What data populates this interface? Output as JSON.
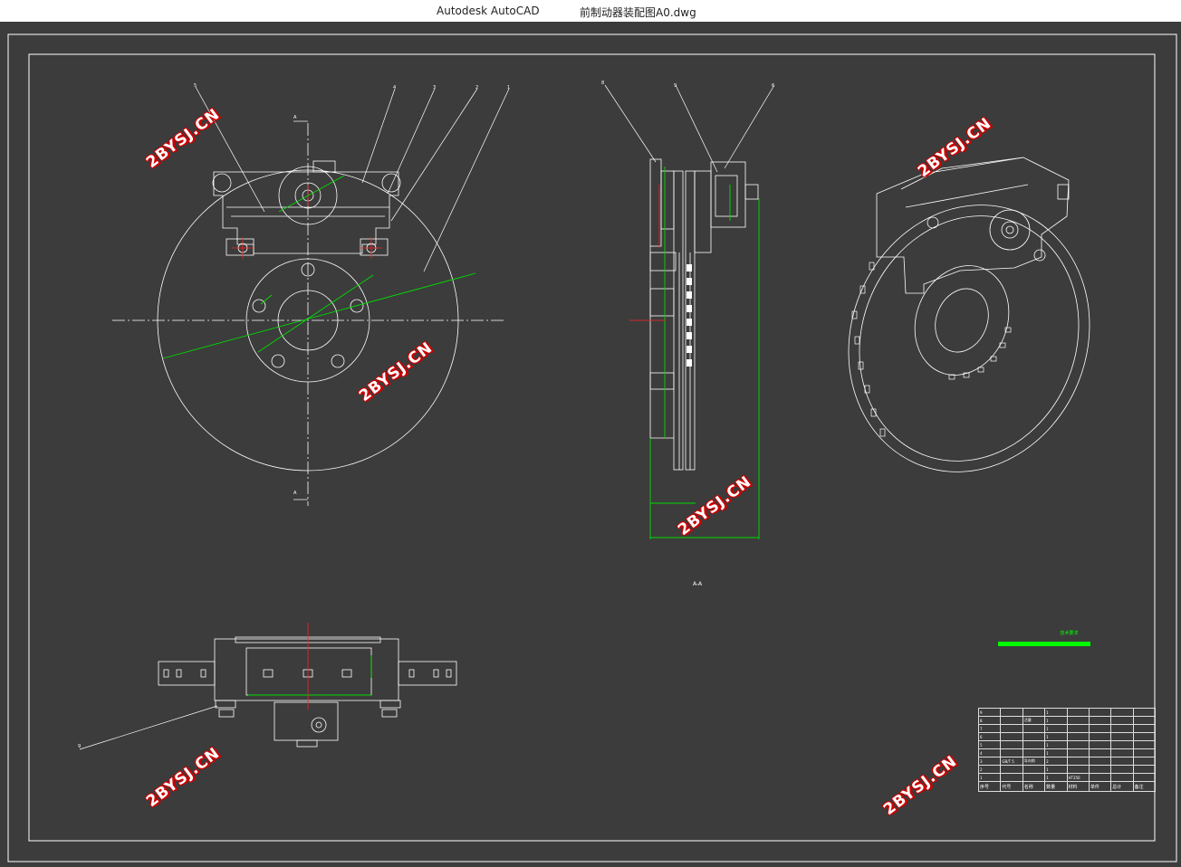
{
  "titlebar": {
    "app_name": "Autodesk AutoCAD",
    "document_name": "前制动器装配图A0.dwg"
  },
  "watermarks": [
    {
      "id": "wm1",
      "text": "2BYSJ.CN"
    },
    {
      "id": "wm2",
      "text": "2BYSJ.CN"
    },
    {
      "id": "wm3",
      "text": "2BYSJ.CN"
    },
    {
      "id": "wm4",
      "text": "2BYSJ.CN"
    },
    {
      "id": "wm5",
      "text": "2BYSJ.CN"
    },
    {
      "id": "wm6",
      "text": "2BYSJ.CN"
    }
  ],
  "balloons": {
    "front": [
      "5",
      "4",
      "3",
      "2",
      "1"
    ],
    "side": [
      "8",
      "9",
      "6"
    ],
    "top": [
      "9"
    ]
  },
  "section_marks": {
    "top": "A",
    "bottom": "A"
  },
  "side_view_label": "A-A",
  "technical_notes": {
    "title": "技术要求"
  },
  "bom": {
    "header": [
      "序号",
      "代号",
      "名称",
      "数量",
      "材料",
      "单件",
      "总计",
      "备注"
    ],
    "rows": [
      [
        "9",
        "",
        "",
        "1",
        "",
        "",
        "",
        ""
      ],
      [
        "8",
        "",
        "活塞",
        "1",
        "",
        "",
        "",
        ""
      ],
      [
        "7",
        "",
        "",
        "1",
        "",
        "",
        "",
        ""
      ],
      [
        "6",
        "",
        "",
        "1",
        "",
        "",
        "",
        ""
      ],
      [
        "5",
        "",
        "",
        "1",
        "",
        "",
        "",
        ""
      ],
      [
        "4",
        "",
        "",
        "1",
        "",
        "",
        "",
        ""
      ],
      [
        "3",
        "GB/T 5",
        "导向销",
        "2",
        "",
        "",
        "",
        ""
      ],
      [
        "2",
        "",
        "",
        "1",
        "",
        "",
        "",
        ""
      ],
      [
        "1",
        "",
        "",
        "1",
        "HT250",
        "",
        "",
        ""
      ]
    ]
  },
  "colors": {
    "background": "#3c3c3c",
    "lines": "#ffffff",
    "dimensions": "#00dd00",
    "centerline_marks": "#ff2020",
    "watermark_outline": "#cc0000"
  }
}
